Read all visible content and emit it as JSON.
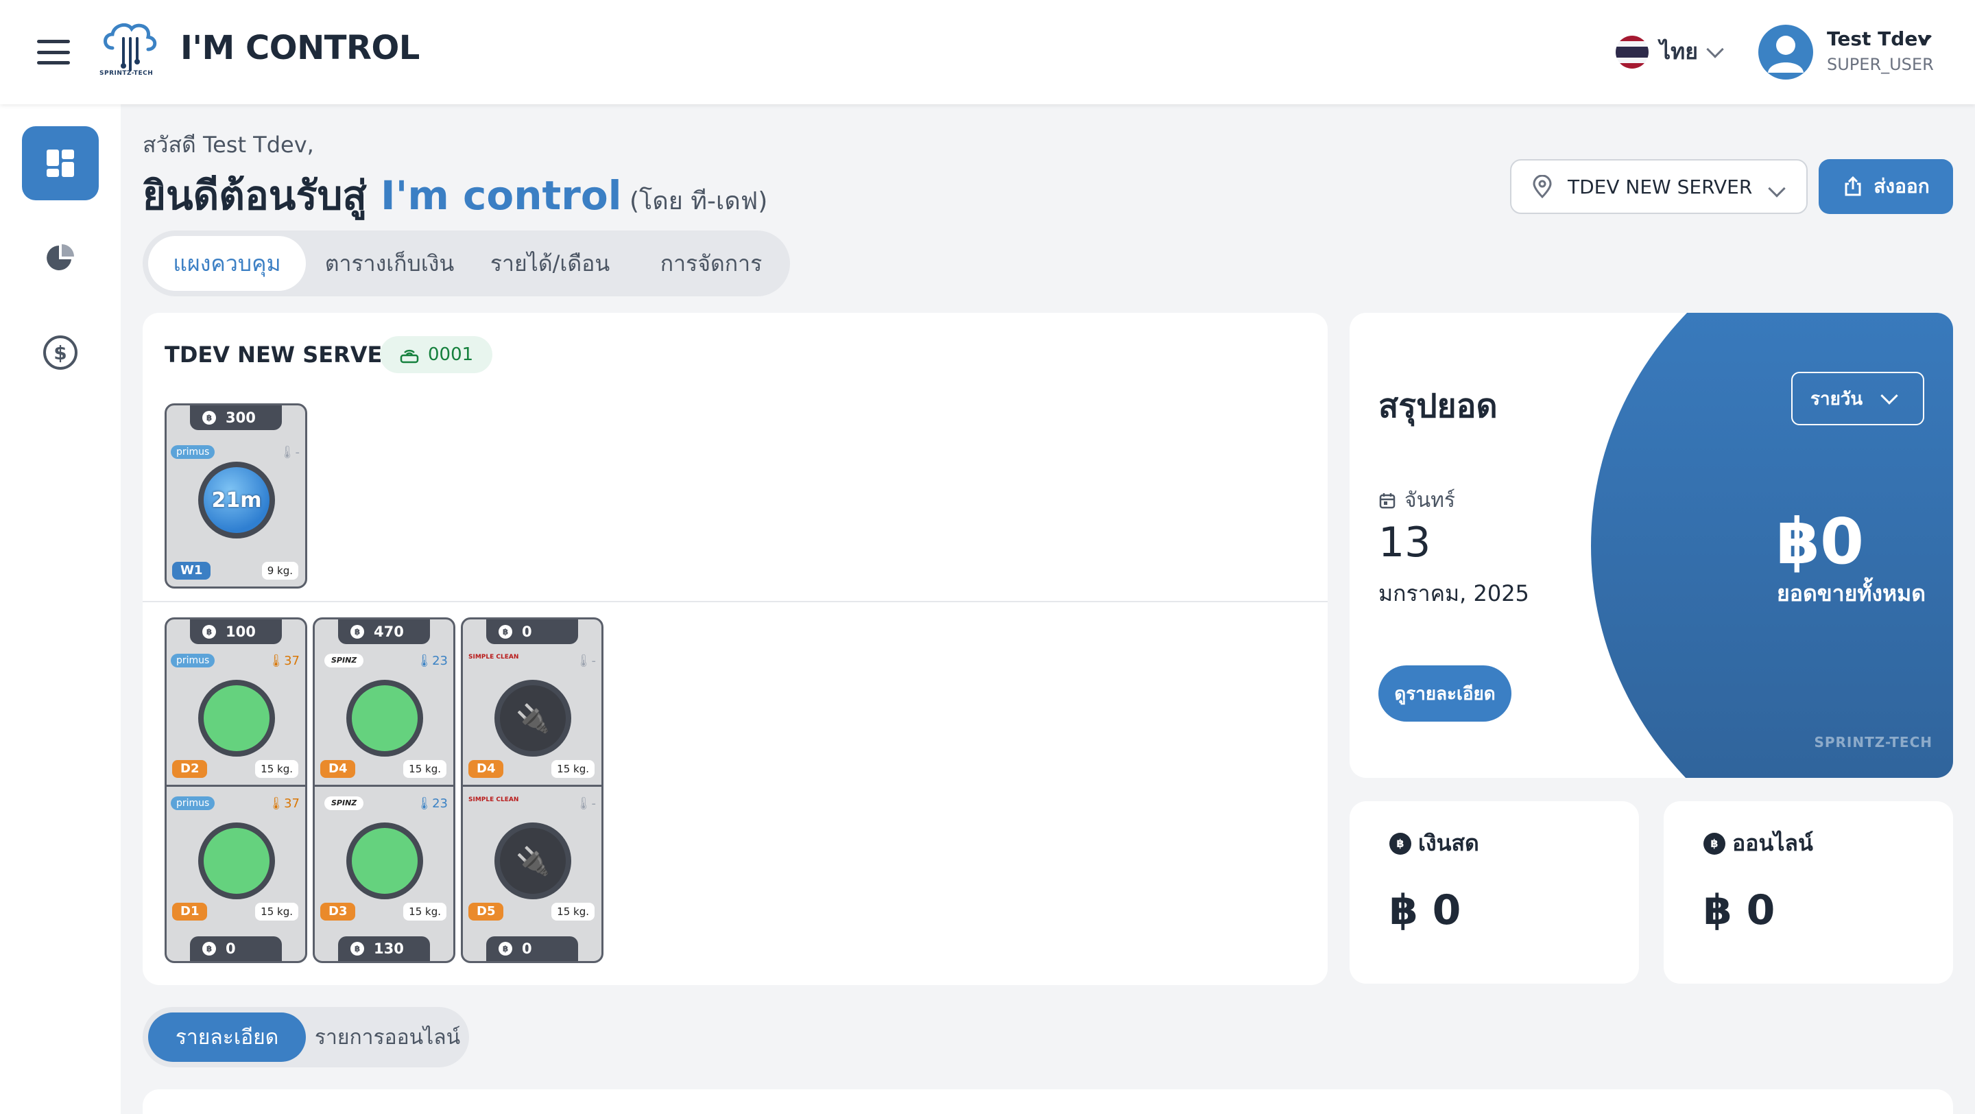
{
  "header": {
    "app_title": "I'M CONTROL",
    "logo_text": "SPRINTZ-TECH",
    "language": "ไทย",
    "user_name": "Test Tdev",
    "user_role": "SUPER_USER"
  },
  "greeting": {
    "hello": "สวัสดี Test Tdev,",
    "welcome_prefix": "ยินดีต้อนรับสู่ ",
    "welcome_brand": "I'm control",
    "welcome_suffix": " (โดย ที-เดฟ)"
  },
  "toolbar": {
    "server_select": "TDEV NEW SERVER",
    "export_label": "ส่งออก"
  },
  "tabs": [
    "แผงควบคุม",
    "ตารางเก็บเงิน",
    "รายได้/เดือน",
    "การจัดการ"
  ],
  "server": {
    "name": "TDEV NEW SERVER",
    "badge": "0001",
    "washer": {
      "price": "300",
      "brand": "primus",
      "temp": "-",
      "display": "21m",
      "label": "W1",
      "kg": "9 kg."
    },
    "dryers": [
      {
        "top_price": "100",
        "bottom_price": "0",
        "units": [
          {
            "brand": "primus",
            "temp": "37",
            "label": "D2",
            "kg": "15 kg."
          },
          {
            "brand": "primus",
            "temp": "37",
            "label": "D1",
            "kg": "15 kg."
          }
        ]
      },
      {
        "top_price": "470",
        "bottom_price": "130",
        "units": [
          {
            "brand": "SPINZ",
            "temp": "23",
            "label": "D4",
            "kg": "15 kg."
          },
          {
            "brand": "SPINZ",
            "temp": "23",
            "label": "D3",
            "kg": "15 kg."
          }
        ]
      },
      {
        "top_price": "0",
        "bottom_price": "0",
        "units": [
          {
            "brand": "SIMPLE CLEAN",
            "temp": "-",
            "label": "D4",
            "kg": "15 kg."
          },
          {
            "brand": "SIMPLE CLEAN",
            "temp": "-",
            "label": "D5",
            "kg": "15 kg."
          }
        ]
      }
    ]
  },
  "summary": {
    "title": "สรุปยอด",
    "period": "รายวัน",
    "day_name": "จันทร์",
    "date": "13",
    "month_year": "มกราคม, 2025",
    "detail_button": "ดูรายละเอียด",
    "total": "฿0",
    "total_label": "ยอดขายทั้งหมด",
    "watermark": "SPRINTZ-TECH"
  },
  "payments": {
    "cash_label": "เงินสด",
    "cash_amount": "฿ 0",
    "online_label": "ออนไลน์",
    "online_amount": "฿ 0"
  },
  "bottom_tabs": [
    "รายละเอียด",
    "รายการออนไลน์"
  ],
  "colors": {
    "accent": "#3b7fc4",
    "run_green": "#65d27e",
    "label_orange": "#ea8a2b"
  }
}
